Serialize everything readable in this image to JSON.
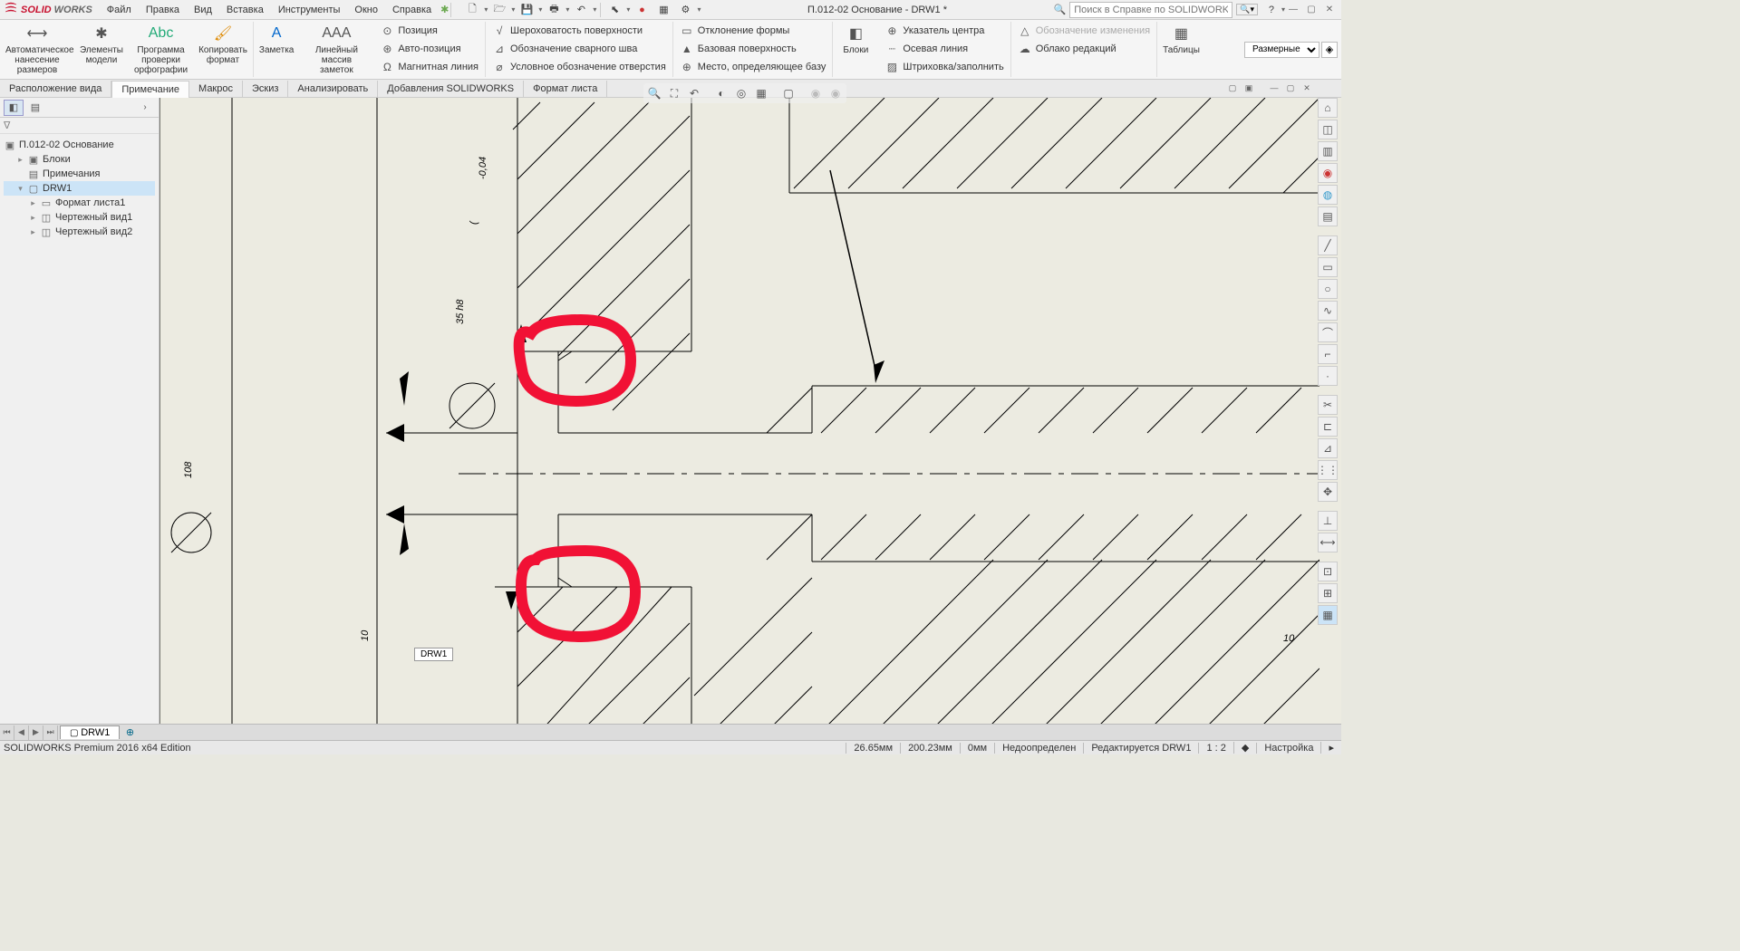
{
  "app": {
    "logo1": "SOLID",
    "logo2": "WORKS",
    "title": "П.012-02 Основание - DRW1 *"
  },
  "menu": [
    "Файл",
    "Правка",
    "Вид",
    "Вставка",
    "Инструменты",
    "Окно",
    "Справка"
  ],
  "search": {
    "placeholder": "Поиск в Справке по SOLIDWORKS"
  },
  "ribbon": {
    "big": [
      {
        "label": "Автоматическое\nнанесение размеров"
      },
      {
        "label": "Элементы\nмодели"
      },
      {
        "label": "Программа\nпроверки\nорфографии"
      },
      {
        "label": "Копировать\nформат"
      },
      {
        "label": "Заметка"
      },
      {
        "label": "Линейный\nмассив заметок"
      }
    ],
    "col1": [
      "Позиция",
      "Авто-позиция",
      "Магнитная линия"
    ],
    "col2": [
      "Шероховатость поверхности",
      "Обозначение сварного шва",
      "Условное обозначение отверстия"
    ],
    "col3": [
      "Отклонение формы",
      "Базовая поверхность",
      "Место, определяющее базу"
    ],
    "blocks": "Блоки",
    "col4": [
      "Указатель центра",
      "Осевая линия",
      "Штриховка/заполнить"
    ],
    "col5": [
      "Обозначение изменения",
      "Облако редакций"
    ],
    "tables": "Таблицы",
    "dim_dd": "Размерные"
  },
  "tabs": [
    "Расположение вида",
    "Примечание",
    "Макрос",
    "Эскиз",
    "Анализировать",
    "Добавления SOLIDWORKS",
    "Формат листа"
  ],
  "active_tab": 1,
  "tree": {
    "root": "П.012-02 Основание",
    "items": [
      {
        "label": "Блоки",
        "indent": 1,
        "exp": "▸"
      },
      {
        "label": "Примечания",
        "indent": 1,
        "exp": ""
      },
      {
        "label": "DRW1",
        "indent": 1,
        "exp": "▾",
        "sel": true
      },
      {
        "label": "Формат листа1",
        "indent": 2,
        "exp": "▸"
      },
      {
        "label": "Чертежный вид1",
        "indent": 2,
        "exp": "▸"
      },
      {
        "label": "Чертежный вид2",
        "indent": 2,
        "exp": "▸"
      }
    ]
  },
  "canvas": {
    "dim1": "108",
    "dim2": "35 h8",
    "dim3": "-0,04",
    "dim4": "10",
    "dim5": "10"
  },
  "sheet": {
    "name": "DRW1",
    "popup": "DRW1"
  },
  "status": {
    "edition": "SOLIDWORKS Premium 2016 x64 Edition",
    "x": "26.65мм",
    "y": "200.23мм",
    "z": "0мм",
    "sel": "Недоопределен",
    "edit": "Редактируется DRW1",
    "scale": "1 : 2",
    "custom": "Настройка"
  }
}
